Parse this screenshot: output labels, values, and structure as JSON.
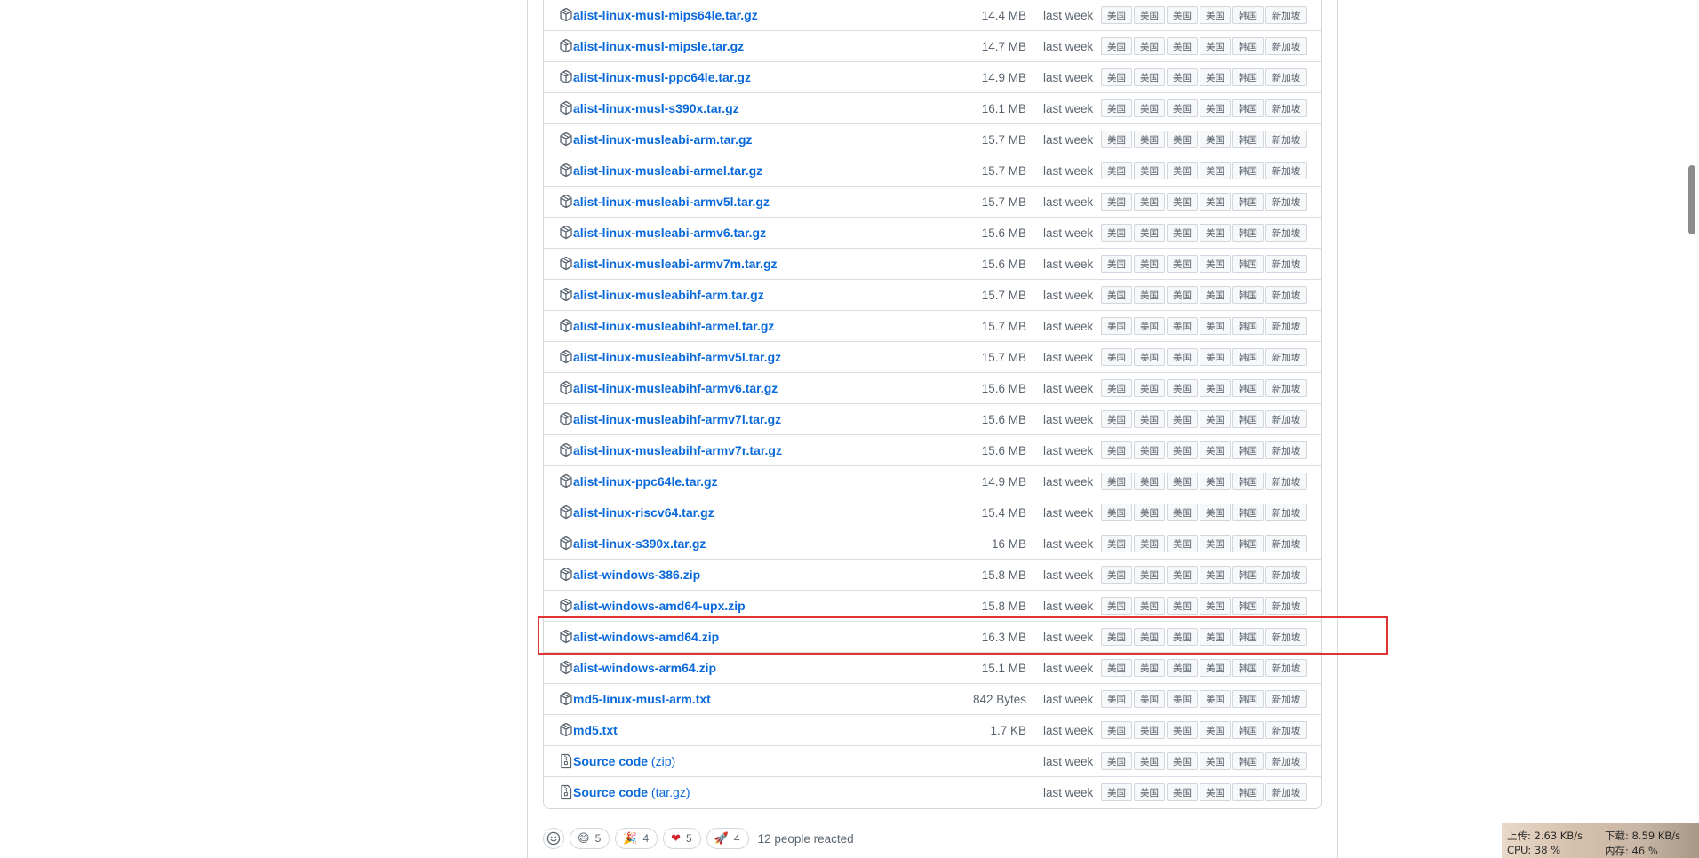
{
  "mirror_labels": [
    "美国",
    "美国",
    "美国",
    "美国",
    "韩国",
    "新加坡"
  ],
  "assets": [
    {
      "name": "alist-linux-musl-mips64le.tar.gz",
      "size": "14.4 MB",
      "date": "last week"
    },
    {
      "name": "alist-linux-musl-mipsle.tar.gz",
      "size": "14.7 MB",
      "date": "last week"
    },
    {
      "name": "alist-linux-musl-ppc64le.tar.gz",
      "size": "14.9 MB",
      "date": "last week"
    },
    {
      "name": "alist-linux-musl-s390x.tar.gz",
      "size": "16.1 MB",
      "date": "last week"
    },
    {
      "name": "alist-linux-musleabi-arm.tar.gz",
      "size": "15.7 MB",
      "date": "last week"
    },
    {
      "name": "alist-linux-musleabi-armel.tar.gz",
      "size": "15.7 MB",
      "date": "last week"
    },
    {
      "name": "alist-linux-musleabi-armv5l.tar.gz",
      "size": "15.7 MB",
      "date": "last week"
    },
    {
      "name": "alist-linux-musleabi-armv6.tar.gz",
      "size": "15.6 MB",
      "date": "last week"
    },
    {
      "name": "alist-linux-musleabi-armv7m.tar.gz",
      "size": "15.6 MB",
      "date": "last week"
    },
    {
      "name": "alist-linux-musleabihf-arm.tar.gz",
      "size": "15.7 MB",
      "date": "last week"
    },
    {
      "name": "alist-linux-musleabihf-armel.tar.gz",
      "size": "15.7 MB",
      "date": "last week"
    },
    {
      "name": "alist-linux-musleabihf-armv5l.tar.gz",
      "size": "15.7 MB",
      "date": "last week"
    },
    {
      "name": "alist-linux-musleabihf-armv6.tar.gz",
      "size": "15.6 MB",
      "date": "last week"
    },
    {
      "name": "alist-linux-musleabihf-armv7l.tar.gz",
      "size": "15.6 MB",
      "date": "last week"
    },
    {
      "name": "alist-linux-musleabihf-armv7r.tar.gz",
      "size": "15.6 MB",
      "date": "last week"
    },
    {
      "name": "alist-linux-ppc64le.tar.gz",
      "size": "14.9 MB",
      "date": "last week"
    },
    {
      "name": "alist-linux-riscv64.tar.gz",
      "size": "15.4 MB",
      "date": "last week"
    },
    {
      "name": "alist-linux-s390x.tar.gz",
      "size": "16 MB",
      "date": "last week"
    },
    {
      "name": "alist-windows-386.zip",
      "size": "15.8 MB",
      "date": "last week"
    },
    {
      "name": "alist-windows-amd64-upx.zip",
      "size": "15.8 MB",
      "date": "last week"
    },
    {
      "name": "alist-windows-amd64.zip",
      "size": "16.3 MB",
      "date": "last week",
      "highlighted": true
    },
    {
      "name": "alist-windows-arm64.zip",
      "size": "15.1 MB",
      "date": "last week"
    },
    {
      "name": "md5-linux-musl-arm.txt",
      "size": "842 Bytes",
      "date": "last week"
    },
    {
      "name": "md5.txt",
      "size": "1.7 KB",
      "date": "last week"
    },
    {
      "name": "Source code",
      "suffix": "(zip)",
      "size": "",
      "date": "last week",
      "icon": "file-zip-icon"
    },
    {
      "name": "Source code",
      "suffix": "(tar.gz)",
      "size": "",
      "date": "last week",
      "icon": "file-zip-icon"
    }
  ],
  "reactions": {
    "items": [
      {
        "emoji": "😄",
        "icon": "smile-emoji",
        "count": "5"
      },
      {
        "emoji": "🎉",
        "icon": "tada-emoji",
        "count": "4"
      },
      {
        "emoji": "❤",
        "icon": "heart-emoji",
        "count": "5"
      },
      {
        "emoji": "🚀",
        "icon": "rocket-emoji",
        "count": "4"
      }
    ],
    "summary": "12 people reacted"
  },
  "net_monitor": {
    "upload": "上传: 2.63 KB/s",
    "download": "下载: 8.59 KB/s",
    "cpu": "CPU: 38 %",
    "memory": "内存: 46 %"
  },
  "colors": {
    "link": "#0969da",
    "muted": "#59636e",
    "highlight_border": "#e03333"
  }
}
